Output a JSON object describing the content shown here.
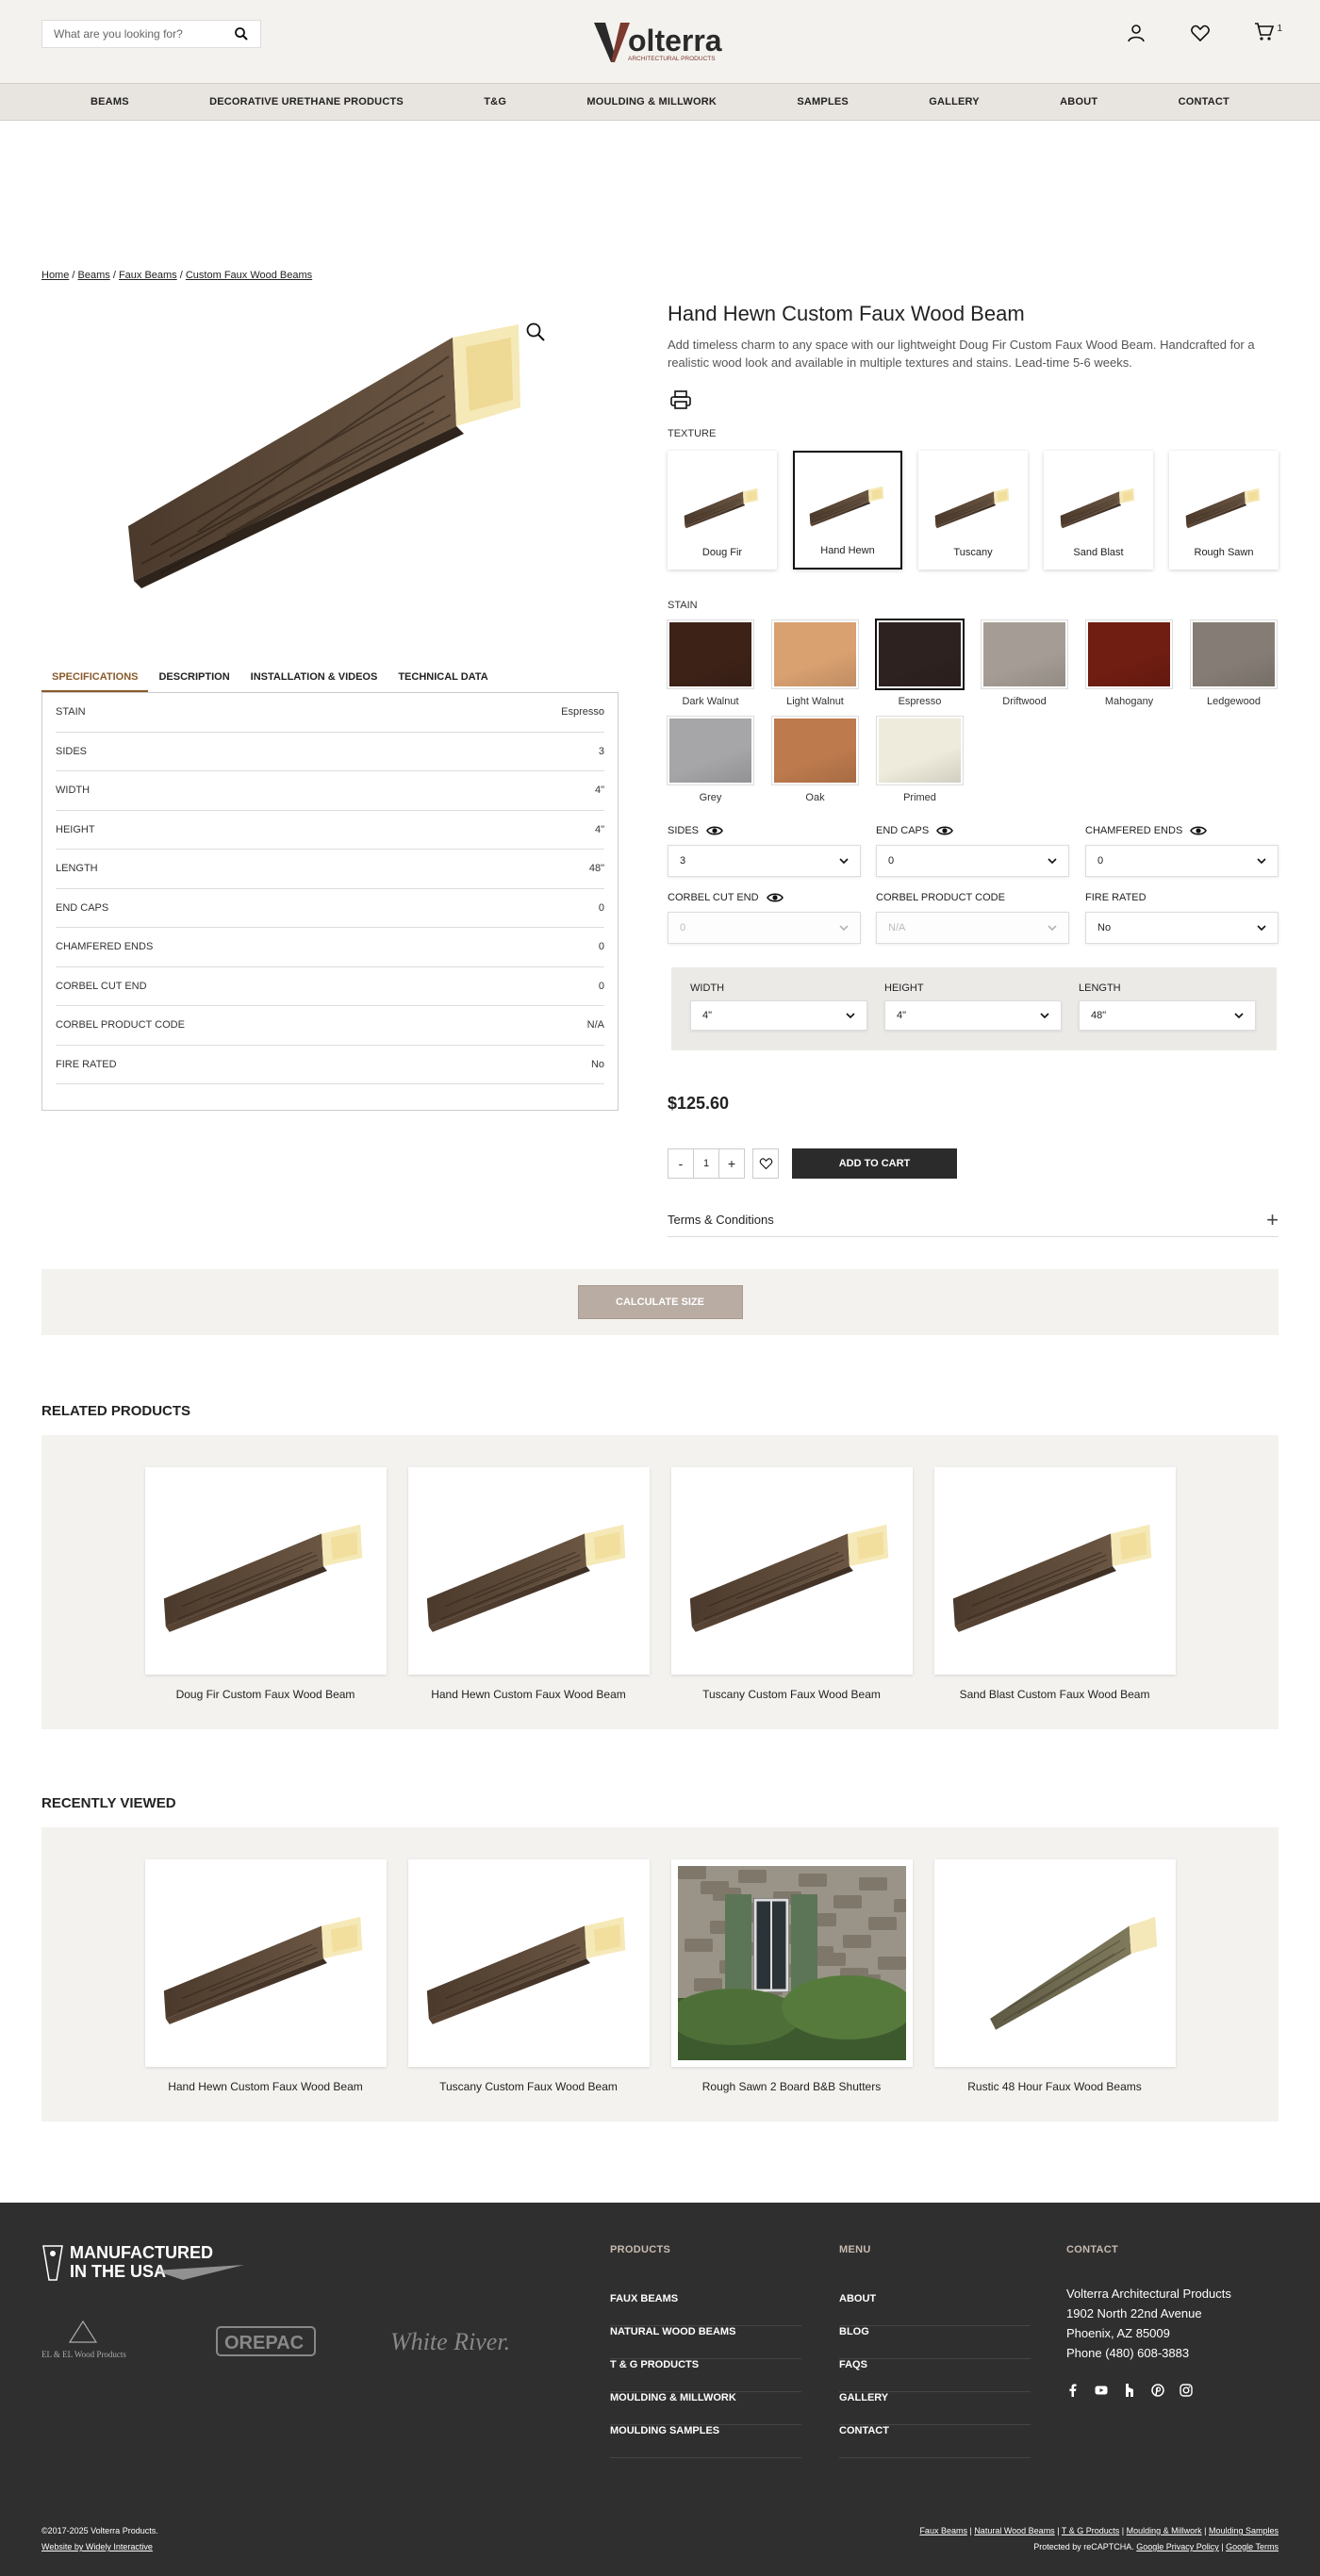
{
  "header": {
    "search_placeholder": "What are you looking for?",
    "logo_text": "Volterra",
    "logo_tagline": "ARCHITECTURAL PRODUCTS",
    "cart_count": "1"
  },
  "nav": [
    "BEAMS",
    "DECORATIVE URETHANE PRODUCTS",
    "T&G",
    "MOULDING & MILLWORK",
    "SAMPLES",
    "GALLERY",
    "ABOUT",
    "CONTACT"
  ],
  "breadcrumb": [
    "Home",
    "Beams",
    "Faux Beams",
    "Custom Faux Wood Beams"
  ],
  "tabs": [
    "SPECIFICATIONS",
    "DESCRIPTION",
    "INSTALLATION & VIDEOS",
    "TECHNICAL DATA"
  ],
  "specs": [
    {
      "k": "STAIN",
      "v": "Espresso"
    },
    {
      "k": "SIDES",
      "v": "3"
    },
    {
      "k": "WIDTH",
      "v": "4\""
    },
    {
      "k": "HEIGHT",
      "v": "4\""
    },
    {
      "k": "LENGTH",
      "v": "48\""
    },
    {
      "k": "END CAPS",
      "v": "0"
    },
    {
      "k": "CHAMFERED ENDS",
      "v": "0"
    },
    {
      "k": "CORBEL CUT END",
      "v": "0"
    },
    {
      "k": "CORBEL PRODUCT CODE",
      "v": "N/A"
    },
    {
      "k": "FIRE RATED",
      "v": "No"
    }
  ],
  "product": {
    "title": "Hand Hewn Custom Faux Wood Beam",
    "description": "Add timeless charm to any space with our lightweight Doug Fir Custom Faux Wood Beam. Handcrafted for a realistic wood look and available in multiple textures and stains. Lead-time 5-6 weeks.",
    "price": "$125.60",
    "qty": "1",
    "add_to_cart": "ADD TO CART",
    "terms": "Terms & Conditions",
    "calc": "CALCULATE SIZE"
  },
  "texture_label": "TEXTURE",
  "textures": [
    "Doug Fir",
    "Hand Hewn",
    "Tuscany",
    "Sand Blast",
    "Rough Sawn"
  ],
  "stain_label": "STAIN",
  "stains": [
    {
      "name": "Dark Walnut",
      "color": "#3d2217"
    },
    {
      "name": "Light Walnut",
      "color": "#d9a070"
    },
    {
      "name": "Espresso",
      "color": "#2e2220"
    },
    {
      "name": "Driftwood",
      "color": "#a59d95"
    },
    {
      "name": "Mahogany",
      "color": "#701d12"
    },
    {
      "name": "Ledgewood",
      "color": "#857d75"
    },
    {
      "name": "Grey",
      "color": "#a6a6a8"
    },
    {
      "name": "Oak",
      "color": "#bd7a4d"
    },
    {
      "name": "Primed",
      "color": "#eeebdc"
    }
  ],
  "options": {
    "sides": {
      "label": "SIDES",
      "value": "3"
    },
    "end_caps": {
      "label": "END CAPS",
      "value": "0"
    },
    "chamfered": {
      "label": "CHAMFERED ENDS",
      "value": "0"
    },
    "corbel_cut": {
      "label": "CORBEL CUT END",
      "value": "0"
    },
    "corbel_code": {
      "label": "CORBEL PRODUCT CODE",
      "value": "N/A"
    },
    "fire": {
      "label": "FIRE RATED",
      "value": "No"
    },
    "width": {
      "label": "WIDTH",
      "value": "4\""
    },
    "height": {
      "label": "HEIGHT",
      "value": "4\""
    },
    "length": {
      "label": "LENGTH",
      "value": "48\""
    }
  },
  "related": {
    "title": "RELATED PRODUCTS",
    "items": [
      "Doug Fir Custom Faux Wood Beam",
      "Hand Hewn Custom Faux Wood Beam",
      "Tuscany Custom Faux Wood Beam",
      "Sand Blast Custom Faux Wood Beam"
    ]
  },
  "recent": {
    "title": "RECENTLY VIEWED",
    "items": [
      "Hand Hewn Custom Faux Wood Beam",
      "Tuscany Custom Faux Wood Beam",
      "Rough Sawn 2 Board B&B Shutters",
      "Rustic 48 Hour Faux Wood Beams"
    ]
  },
  "footer": {
    "made_line1": "MANUFACTURED",
    "made_line2": "IN THE USA",
    "brand1": "EL & EL Wood Products",
    "brand2": "OREPAC",
    "brand3": "White River.",
    "products_title": "PRODUCTS",
    "products": [
      "FAUX BEAMS",
      "NATURAL WOOD BEAMS",
      "T & G PRODUCTS",
      "MOULDING & MILLWORK",
      "MOULDING SAMPLES"
    ],
    "menu_title": "MENU",
    "menu": [
      "ABOUT",
      "BLOG",
      "FAQS",
      "GALLERY",
      "CONTACT"
    ],
    "contact_title": "CONTACT",
    "contact": [
      "Volterra Architectural Products",
      "1902 North 22nd Avenue",
      "Phoenix, AZ 85009",
      "Phone (480) 608-3883"
    ],
    "copyright": "©2017-2025 Volterra Products.",
    "credit": "Website by Widely Interactive",
    "legal_links": [
      "Faux Beams",
      "Natural Wood Beams",
      "T & G Products",
      "Moulding & Millwork",
      "Moulding Samples"
    ],
    "recaptcha": "Protected by reCAPTCHA.",
    "privacy": "Google Privacy Policy",
    "terms": "Google Terms"
  }
}
